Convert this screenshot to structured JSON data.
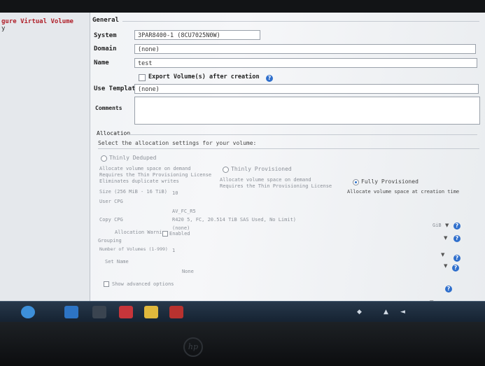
{
  "nav": {
    "title": "gure Virtual Volume",
    "subitem": "y"
  },
  "form": {
    "general_header": "General",
    "system_label": "System",
    "system_value": "3PAR8400-1 (8CU7025N0W)",
    "domain_label": "Domain",
    "domain_value": "(none)",
    "name_label": "Name",
    "name_value": "test",
    "export_label": "Export Volume(s) after creation",
    "template_label": "Use Template",
    "template_value": "(none)",
    "comments_label": "Comments"
  },
  "allocation": {
    "header": "Allocation",
    "instruction": "Select the allocation settings for your volume:",
    "thinly_deduped": {
      "label": "Thinly Deduped",
      "line1": "Allocate volume space on demand",
      "line2": "Requires the Thin Provisioning License",
      "line3": "Eliminates duplicate writes"
    },
    "thinly_provisioned": {
      "label": "Thinly Provisioned",
      "line1": "Allocate volume space on demand",
      "line2": "Requires the Thin Provisioning License"
    },
    "fully_provisioned": {
      "label": "Fully Provisioned",
      "line1": "Allocate volume space at creation time"
    }
  },
  "lower": {
    "size_label": "Size (256 MiB - 16 TiB)",
    "size_value": "10",
    "size_unit": "GiB",
    "user_cpg_label": "User CPG",
    "user_cpg_value": "AV_FC_R5",
    "copy_cpg_label": "Copy CPG",
    "copy_cpg_value": "(none)",
    "cpg_info": "R420 5, FC, 20.514 TiB SAS Used, No Limit)",
    "allocation_warning_label": "Allocation Warning",
    "allocation_warning_value": "Enabled",
    "grouping_label": "Grouping",
    "num_volumes_label": "Number of Volumes (1-999)",
    "num_volumes_value": "1",
    "set_name_label": "Set Name",
    "set_name_value": "None",
    "advanced_label": "Show advanced options"
  },
  "icons": {
    "help": "help-icon",
    "dropdown": "chevron-down-icon"
  },
  "colors": {
    "nav_title": "#b0202a",
    "help_icon": "#2f6fcc",
    "taskbar": "#1f2f41"
  }
}
